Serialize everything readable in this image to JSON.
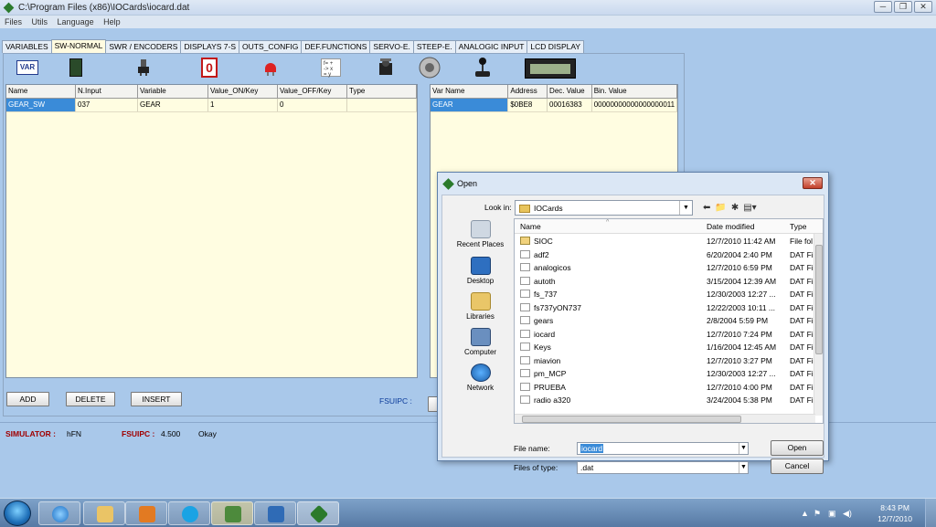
{
  "window": {
    "title": "C:\\Program Files (x86)\\IOCards\\iocard.dat",
    "min": "─",
    "max": "❐",
    "close": "✕"
  },
  "menu": [
    "Files",
    "Utils",
    "Language",
    "Help"
  ],
  "tabs": [
    "VARIABLES",
    "SW-NORMAL",
    "SWR / ENCODERS",
    "DISPLAYS 7-S",
    "OUTS_CONFIG",
    "DEF.FUNCTIONS",
    "SERVO-E.",
    "STEEP-E.",
    "ANALOGIC INPUT",
    "LCD DISPLAY"
  ],
  "active_tab": "SW-NORMAL",
  "toolbar_icons": [
    "var-icon",
    "switch-board-icon",
    "encoder-icon",
    "seven-segment-icon",
    "output-led-icon",
    "functions-icon",
    "servo-icon",
    "stepper-icon",
    "joystick-icon",
    "lcd-icon"
  ],
  "left_grid": {
    "headers": [
      "Name",
      "N.Input",
      "Variable",
      "Value_ON/Key",
      "Value_OFF/Key",
      "Type"
    ],
    "rows": [
      [
        "GEAR_SW",
        "037",
        "GEAR",
        "1",
        "0",
        ""
      ]
    ]
  },
  "right_grid": {
    "headers": [
      "Var Name",
      "Address",
      "Dec. Value",
      "Bin. Value"
    ],
    "rows": [
      [
        "GEAR",
        "$0BE8",
        "00016383",
        "00000000000000000011"
      ]
    ]
  },
  "buttons": {
    "add": "ADD",
    "delete": "DELETE",
    "insert": "INSERT"
  },
  "fsuipc_label": "FSUIPC :",
  "status": {
    "simulator_label": "SIMULATOR :",
    "simulator_value": "hFN",
    "fsuipc_label": "FSUIPC :",
    "fsuipc_value": "4.500",
    "state": "Okay"
  },
  "dialog": {
    "title": "Open",
    "look_in_label": "Look in:",
    "look_in_value": "IOCards",
    "places": [
      "Recent Places",
      "Desktop",
      "Libraries",
      "Computer",
      "Network"
    ],
    "columns": {
      "name": "Name",
      "date": "Date modified",
      "type": "Type"
    },
    "files": [
      {
        "name": "SIOC",
        "date": "12/7/2010 11:42 AM",
        "type": "File fol",
        "folder": true
      },
      {
        "name": "adf2",
        "date": "6/20/2004 2:40 PM",
        "type": "DAT Fi",
        "folder": false
      },
      {
        "name": "analogicos",
        "date": "12/7/2010 6:59 PM",
        "type": "DAT Fi",
        "folder": false
      },
      {
        "name": "autoth",
        "date": "3/15/2004 12:39 AM",
        "type": "DAT Fi",
        "folder": false
      },
      {
        "name": "fs_737",
        "date": "12/30/2003 12:27 ...",
        "type": "DAT Fi",
        "folder": false
      },
      {
        "name": "fs737yON737",
        "date": "12/22/2003 10:11 ...",
        "type": "DAT Fi",
        "folder": false
      },
      {
        "name": "gears",
        "date": "2/8/2004 5:59 PM",
        "type": "DAT Fi",
        "folder": false
      },
      {
        "name": "iocard",
        "date": "12/7/2010 7:24 PM",
        "type": "DAT Fi",
        "folder": false
      },
      {
        "name": "Keys",
        "date": "1/16/2004 12:45 AM",
        "type": "DAT Fi",
        "folder": false
      },
      {
        "name": "miavion",
        "date": "12/7/2010 3:27 PM",
        "type": "DAT Fi",
        "folder": false
      },
      {
        "name": "pm_MCP",
        "date": "12/30/2003 12:27 ...",
        "type": "DAT Fi",
        "folder": false
      },
      {
        "name": "PRUEBA",
        "date": "12/7/2010 4:00 PM",
        "type": "DAT Fi",
        "folder": false
      },
      {
        "name": "radio a320",
        "date": "3/24/2004 5:38 PM",
        "type": "DAT Fi",
        "folder": false
      }
    ],
    "file_name_label": "File name:",
    "file_name_value": "iocard",
    "file_type_label": "Files of type:",
    "file_type_value": ".dat",
    "open": "Open",
    "cancel": "Cancel"
  },
  "taskbar": {
    "apps": [
      "internet-explorer-icon",
      "explorer-folder-icon",
      "media-player-icon",
      "skype-icon",
      "network-app-icon",
      "flight-sim-icon",
      "iocards-icon"
    ],
    "clock_time": "8:43 PM",
    "clock_date": "12/7/2010"
  }
}
